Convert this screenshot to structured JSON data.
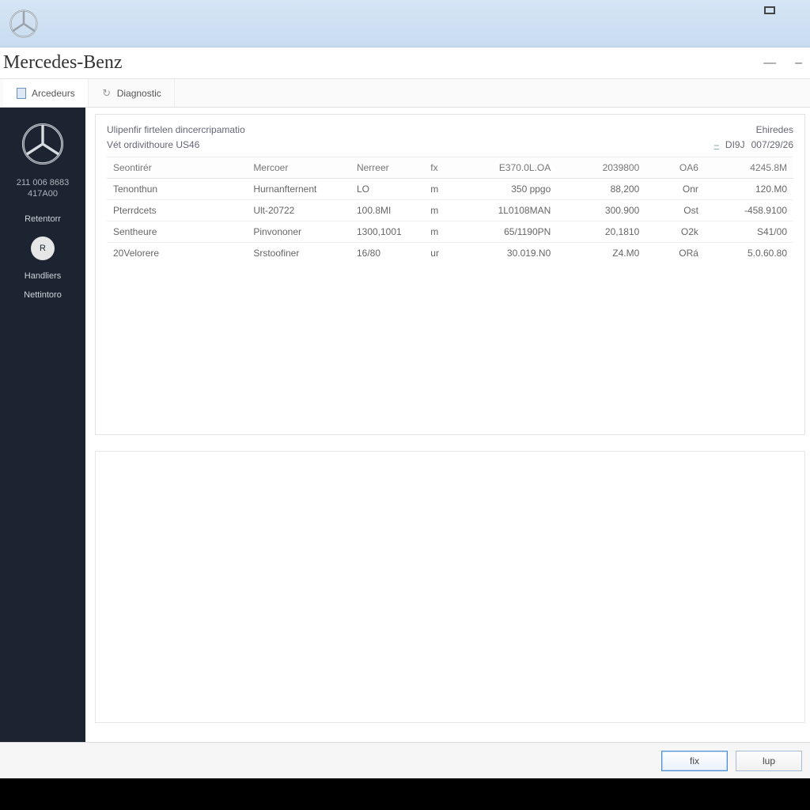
{
  "app": {
    "title": "Mercedes-Benz"
  },
  "tabs": [
    {
      "label": "Arcedeurs"
    },
    {
      "label": "Diagnostic"
    }
  ],
  "sidebar": {
    "id_line1": "211 006 8683",
    "id_line2": "417A00",
    "items": [
      "Retentorr",
      "Handliers",
      "Nettintoro"
    ],
    "round_label": "R"
  },
  "panel": {
    "heading": "Ulipenfir firtelen dincercripamatio",
    "subheading": "Vét ordivithoure US46",
    "right_label": "Ehiredes",
    "date_prefix": "DI9J",
    "date_value": "007/29/26",
    "filter_glyph": "⎯"
  },
  "table": {
    "headers": [
      "Seontirér",
      "Mercoer",
      "Nerreer",
      "fx",
      "E370.0L.OA",
      "2039800",
      "OA6",
      "4245.8M"
    ],
    "rows": [
      [
        "Tenonthun",
        "Hurnanfternent",
        "LO",
        "m",
        "350 ppgo",
        "88,200",
        "Onr",
        "120.M0"
      ],
      [
        "Pterrdcets",
        "Ult-20722",
        "100.8MI",
        "m",
        "1L0108MAN",
        "300.900",
        "Ost",
        "-458.9100"
      ],
      [
        "Sentheure",
        "Pinvononer",
        "1300,1001",
        "m",
        "65/1190PN",
        "20,1810",
        "O2k",
        "S41/00"
      ],
      [
        "20Velorere",
        "Srstoofiner",
        "16/80",
        "ur",
        "30.019.N0",
        "Z4.M0",
        "ORá",
        "5.0.60.80"
      ]
    ]
  },
  "footer": {
    "primary": "fix",
    "secondary": "lup"
  }
}
